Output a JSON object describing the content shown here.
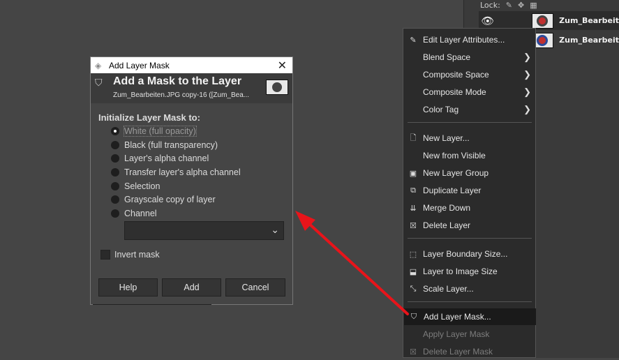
{
  "layers_panel": {
    "lock_label": "Lock:",
    "layers": [
      {
        "name": "Zum_Bearbeit"
      },
      {
        "name": "Zum_Bearbeit"
      }
    ]
  },
  "context_menu": {
    "items": [
      {
        "label": "Edit Layer Attributes...",
        "icon": "edit-icon"
      },
      {
        "label": "Blend Space",
        "submenu": true
      },
      {
        "label": "Composite Space",
        "submenu": true
      },
      {
        "label": "Composite Mode",
        "submenu": true
      },
      {
        "label": "Color Tag",
        "submenu": true
      },
      {
        "label": "New Layer...",
        "icon": "new-layer-icon"
      },
      {
        "label": "New from Visible"
      },
      {
        "label": "New Layer Group",
        "icon": "folder-icon"
      },
      {
        "label": "Duplicate Layer",
        "icon": "duplicate-icon"
      },
      {
        "label": "Merge Down",
        "icon": "merge-icon"
      },
      {
        "label": "Delete Layer",
        "icon": "delete-icon"
      },
      {
        "label": "Layer Boundary Size...",
        "icon": "boundary-icon"
      },
      {
        "label": "Layer to Image Size",
        "icon": "fit-icon"
      },
      {
        "label": "Scale Layer...",
        "icon": "scale-icon"
      },
      {
        "label": "Add Layer Mask...",
        "icon": "mask-icon",
        "highlighted": true
      },
      {
        "label": "Apply Layer Mask",
        "disabled": true
      },
      {
        "label": "Delete Layer Mask",
        "icon": "delete-mask-icon",
        "disabled": true
      }
    ]
  },
  "dialog": {
    "window_title": "Add Layer Mask",
    "heading": "Add a Mask to the Layer",
    "subtitle": "Zum_Bearbeiten.JPG copy-16 ([Zum_Bea...",
    "section_label": "Initialize Layer Mask to:",
    "options": [
      "White (full opacity)",
      "Black (full transparency)",
      "Layer's alpha channel",
      "Transfer layer's alpha channel",
      "Selection",
      "Grayscale copy of layer",
      "Channel"
    ],
    "selected_option": "White (full opacity)",
    "channel_value": "",
    "invert_label": "Invert mask",
    "invert_checked": false,
    "buttons": {
      "help": "Help",
      "add": "Add",
      "cancel": "Cancel"
    }
  },
  "annotation": {
    "arrow_color": "#e8141a"
  }
}
